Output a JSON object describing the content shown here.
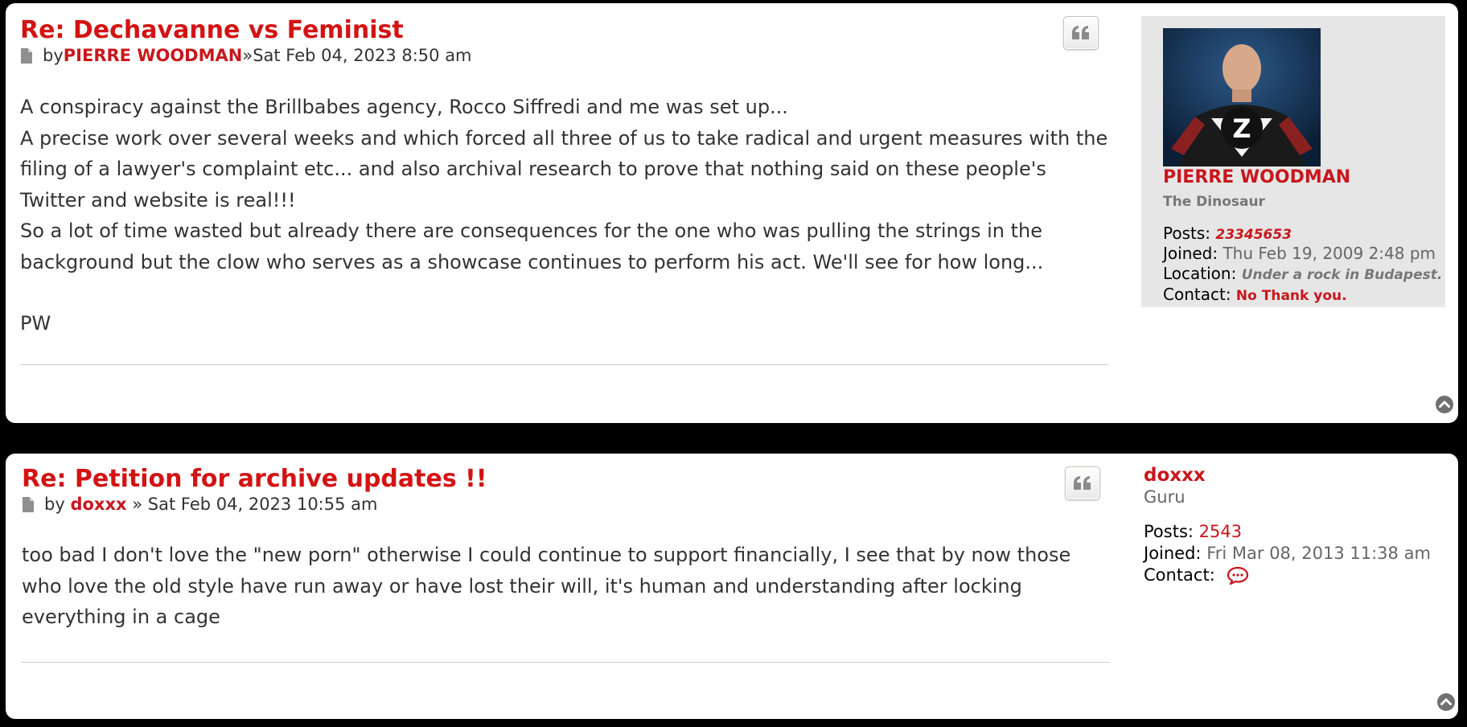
{
  "posts": [
    {
      "title": "Re: Dechavanne vs Feminist",
      "by_label": "by",
      "author": "PIERRE WOODMAN",
      "separator": "»",
      "date": "Sat Feb 04, 2023 8:50 am",
      "body": [
        "A conspiracy against the Brillbabes agency, Rocco Siffredi and me was set up...",
        "A precise work over several weeks and which forced all three of us to take radical and urgent measures with the filing of a lawyer's complaint etc... and also archival research to prove that nothing said on these people's Twitter and website is real!!!",
        "So a lot of time wasted but already there are consequences for the one who was pulling the strings in the background but the clow who serves as a showcase continues to perform his act. We'll see for how long...",
        "",
        "PW"
      ],
      "profile": {
        "name": "PIERRE WOODMAN",
        "rank": "The Dinosaur",
        "posts_label": "Posts:",
        "posts_value": "23345653",
        "joined_label": "Joined:",
        "joined_value": "Thu Feb 19, 2009 2:48 pm",
        "location_label": "Location:",
        "location_value": "Under a rock in Budapest.",
        "contact_label": "Contact:",
        "contact_value": "No Thank you."
      }
    },
    {
      "title": "Re: Petition for archive updates !!",
      "by_label": "by",
      "author": "doxxx",
      "separator": "»",
      "date": "Sat Feb 04, 2023 10:55 am",
      "body": [
        "too bad I don't love the \"new porn\" otherwise I could continue to support financially, I see that by now those who love the old style have run away or have lost their will, it's human and understanding after locking everything in a cage"
      ],
      "profile": {
        "name": "doxxx",
        "rank": "Guru",
        "posts_label": "Posts:",
        "posts_value": "2543",
        "joined_label": "Joined:",
        "joined_value": "Fri Mar 08, 2013 11:38 am",
        "contact_label": "Contact:"
      }
    }
  ],
  "icons": {
    "post": "document-icon",
    "quote": "quote-icon",
    "top": "back-to-top-icon",
    "contact": "speech-bubble-icon"
  },
  "colors": {
    "accent": "#d31313",
    "background": "#000000",
    "panel": "#ffffff",
    "profile_bg": "#e6e6e6"
  }
}
